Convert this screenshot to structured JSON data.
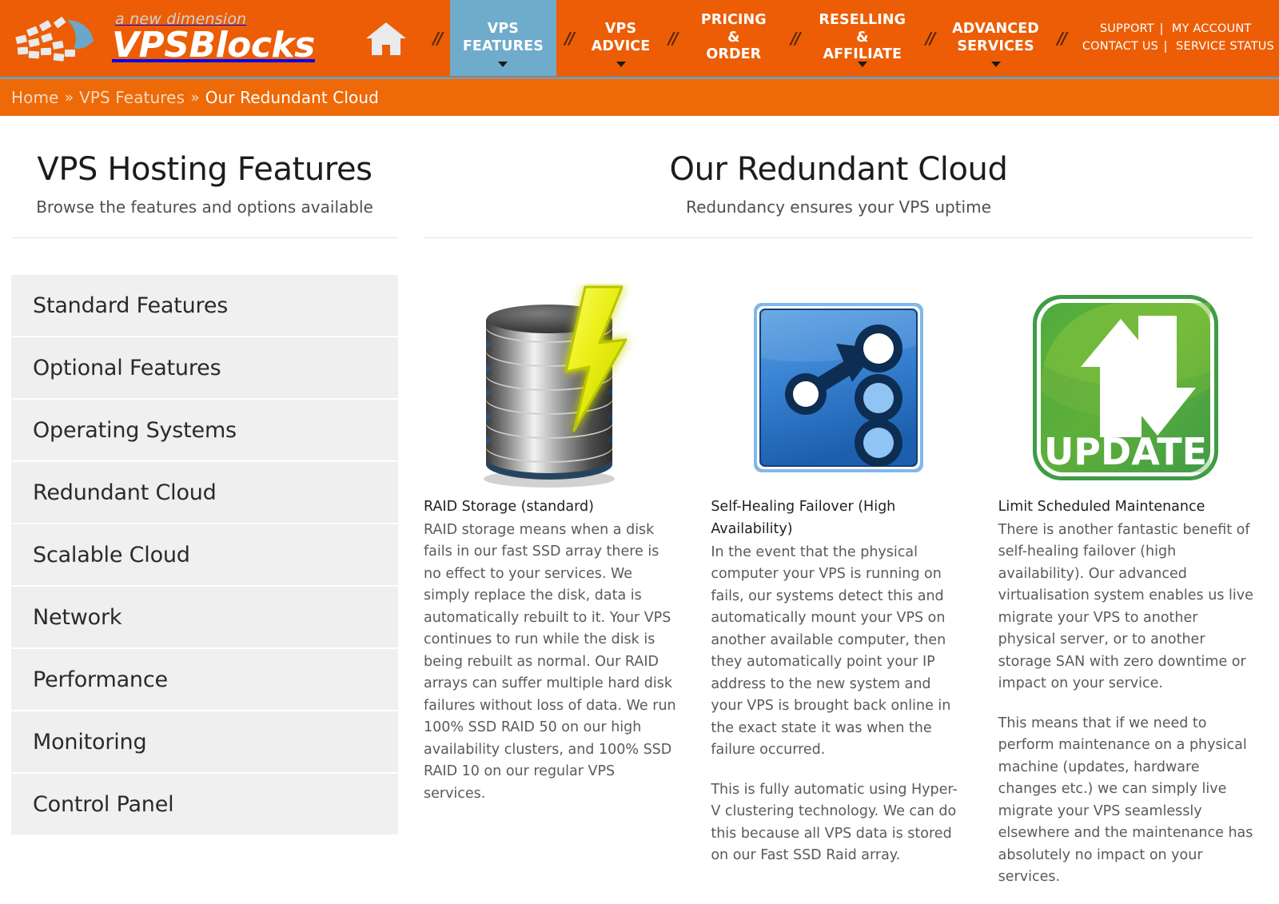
{
  "brand": {
    "tagline": "a new dimension",
    "name": "VPSBlocks"
  },
  "nav": {
    "separator": "//",
    "home_label": "Home",
    "items": [
      {
        "label": "VPS\nFEATURES",
        "active": true,
        "has_dropdown": true
      },
      {
        "label": "VPS\nADVICE",
        "active": false,
        "has_dropdown": true
      },
      {
        "label": "PRICING &\nORDER",
        "active": false,
        "has_dropdown": false
      },
      {
        "label": "RESELLING\n& AFFILIATE",
        "active": false,
        "has_dropdown": true
      },
      {
        "label": "ADVANCED\nSERVICES",
        "active": false,
        "has_dropdown": true
      }
    ],
    "util": {
      "support": "SUPPORT",
      "my_account": "MY ACCOUNT",
      "contact_us": "CONTACT US",
      "service_status": "SERVICE STATUS"
    }
  },
  "breadcrumb": {
    "separator": "»",
    "items": [
      "Home",
      "VPS Features",
      "Our Redundant Cloud"
    ]
  },
  "sidebar": {
    "title": "VPS Hosting Features",
    "subtitle": "Browse the features and options available",
    "items": [
      {
        "label": "Standard Features"
      },
      {
        "label": "Optional Features"
      },
      {
        "label": "Operating Systems"
      },
      {
        "label": "Redundant Cloud"
      },
      {
        "label": "Scalable Cloud"
      },
      {
        "label": "Network"
      },
      {
        "label": "Performance"
      },
      {
        "label": "Monitoring"
      },
      {
        "label": "Control Panel"
      }
    ]
  },
  "main": {
    "title": "Our Redundant Cloud",
    "subtitle": "Redundancy ensures your VPS uptime",
    "cards": [
      {
        "icon": "disk-stack-lightning-icon",
        "title": "RAID Storage (standard)",
        "paragraphs": [
          "RAID storage means when a disk fails in our fast SSD array there is no effect to your services. We simply replace the disk, data is automatically rebuilt to it. Your VPS continues to run while the disk is being rebuilt as normal. Our RAID arrays can suffer multiple hard disk failures without loss of data. We run 100% SSD RAID 50 on our high availability clusters, and 100% SSD RAID 10 on our regular VPS services."
        ]
      },
      {
        "icon": "failover-arrow-nodes-icon",
        "title": "Self-Healing Failover  (High Availability)",
        "paragraphs": [
          "In the event that the physical computer your VPS is running on fails, our systems detect this and automatically mount your VPS on another available computer, then they automatically point your IP address to the new system and your VPS is brought back online in the exact state it was when the failure occurred.",
          "This is fully automatic using Hyper-V clustering technology. We can do this because all VPS data is stored on our Fast SSD Raid array."
        ]
      },
      {
        "icon": "update-arrows-icon",
        "icon_label": "UPDATE",
        "title": "Limit Scheduled Maintenance",
        "paragraphs": [
          "There is another fantastic benefit of self-healing failover (high availability). Our advanced virtualisation system enables us live migrate your VPS to another physical server, or to another storage SAN with zero downtime or impact on your service.",
          "This means that if we need to perform maintenance on a physical machine (updates, hardware changes etc.) we can simply live migrate your VPS seamlessly elsewhere and the maintenance has absolutely no impact on your services."
        ]
      }
    ]
  },
  "colors": {
    "brand_orange": "#EC5D06",
    "breadcrumb_orange": "#EE6907",
    "active_tab_blue": "#6FABCB",
    "sidebar_item_bg": "#F0F0F0",
    "body_text": "#5A5A5A"
  }
}
